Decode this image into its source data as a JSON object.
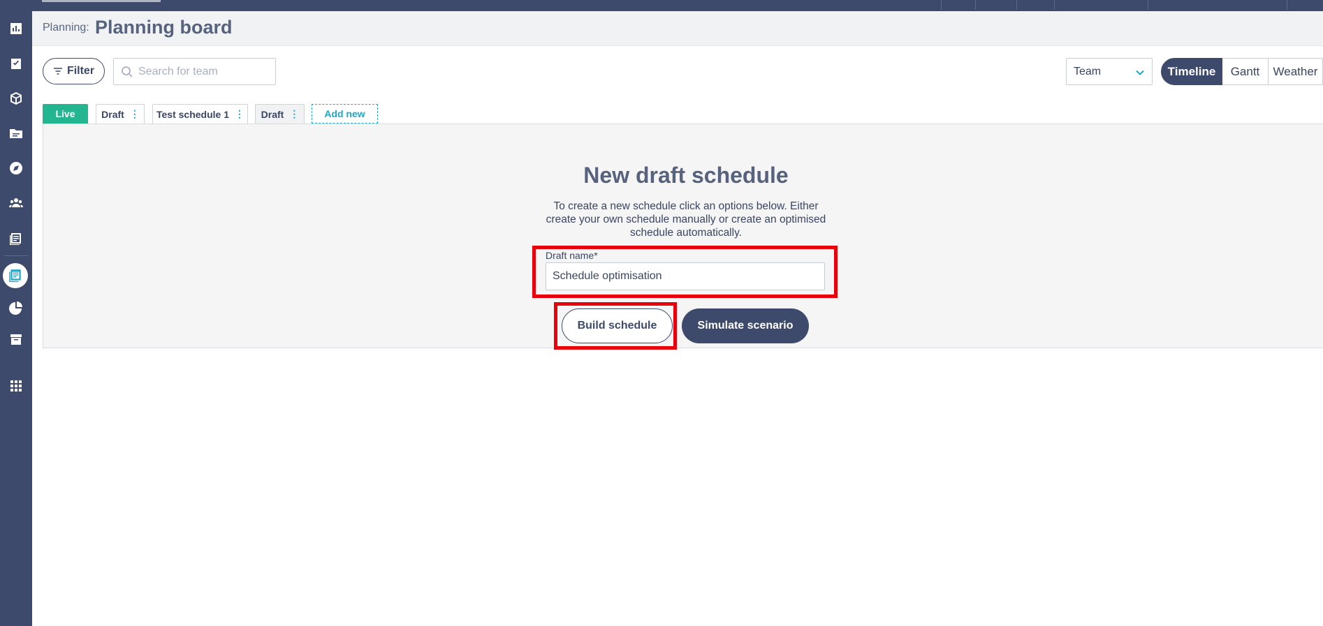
{
  "header": {
    "breadcrumb": "Planning:",
    "title": "Planning board"
  },
  "toolbar": {
    "filter_label": "Filter",
    "search_placeholder": "Search for team",
    "group_select": "Team",
    "views": [
      "Timeline",
      "Gantt",
      "Weather"
    ],
    "active_view": "Timeline"
  },
  "tabs": {
    "live": "Live",
    "items": [
      "Draft",
      "Test schedule 1",
      "Draft"
    ],
    "add": "Add new"
  },
  "panel": {
    "title": "New draft schedule",
    "description": "To create a new schedule click an options below. Either create your own schedule manually or create an optimised schedule automatically.",
    "draft_label": "Draft name*",
    "draft_value": "Schedule optimisation",
    "build_label": "Build schedule",
    "simulate_label": "Simulate scenario"
  },
  "colors": {
    "navy": "#3d4a6b",
    "teal": "#1fa6c9",
    "green": "#22b58f",
    "highlight": "#e8000a"
  },
  "icons": {
    "sidebar": [
      "chart-icon",
      "checklist-icon",
      "cube-icon",
      "folder-icon",
      "compass-icon",
      "people-icon",
      "schedule-icon",
      "planning-icon",
      "pie-chart-icon",
      "archive-icon",
      "apps-grid-icon"
    ]
  }
}
